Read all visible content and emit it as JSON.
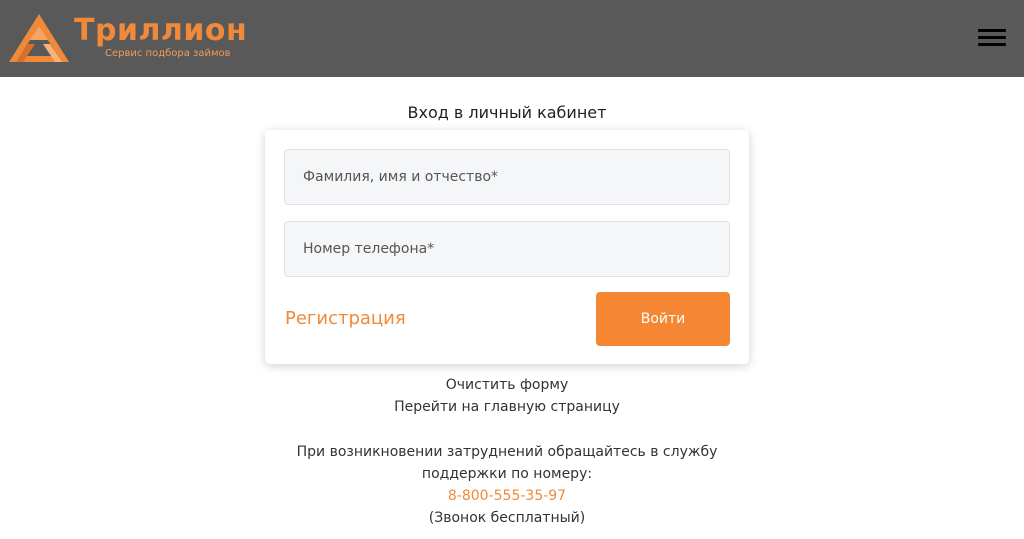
{
  "header": {
    "logo_title": "Триллион",
    "logo_subtitle": "Сервис подбора займов",
    "menu_icon": "hamburger-menu-icon",
    "background_color": "#595959",
    "brand_color": "#f08a3a"
  },
  "login": {
    "title": "Вход в личный кабинет",
    "name_placeholder": "Фамилия, имя и отчество*",
    "name_value": "",
    "phone_placeholder": "Номер телефона*",
    "phone_value": "",
    "register_label": "Регистрация",
    "submit_label": "Войти",
    "button_color": "#f58634"
  },
  "links": {
    "clear_form": "Очистить форму",
    "go_home": "Перейти на главную страницу"
  },
  "support": {
    "text_line1": "При возникновении затруднений обращайтесь в службу",
    "text_line2": "поддержки по номеру:",
    "phone": "8-800-555-35-97",
    "note": "(Звонок бесплатный)"
  }
}
